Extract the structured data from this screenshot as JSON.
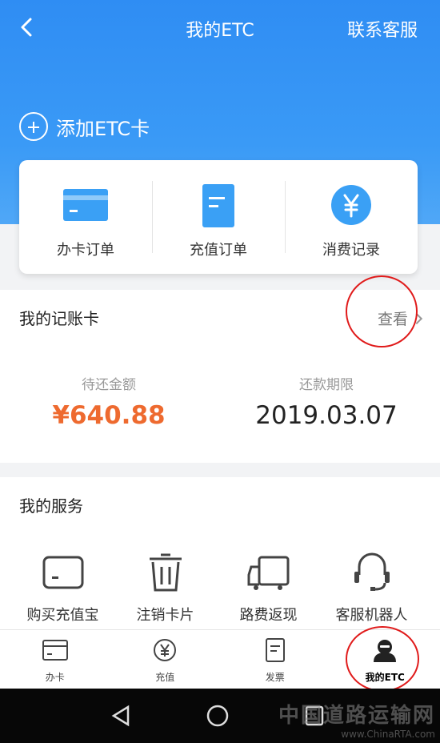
{
  "header": {
    "title": "我的ETC",
    "right_link": "联系客服"
  },
  "add_card": {
    "label": "添加ETC卡"
  },
  "quick": [
    {
      "label": "办卡订单",
      "icon": "card-icon"
    },
    {
      "label": "充值订单",
      "icon": "document-icon"
    },
    {
      "label": "消费记录",
      "icon": "yuan-icon"
    }
  ],
  "account": {
    "title": "我的记账卡",
    "view_label": "查看",
    "due_amount_label": "待还金额",
    "due_amount_value": "¥640.88",
    "due_date_label": "还款期限",
    "due_date_value": "2019.03.07"
  },
  "services": {
    "title": "我的服务",
    "items": [
      {
        "label": "购买充值宝",
        "icon": "device-icon"
      },
      {
        "label": "注销卡片",
        "icon": "trash-icon"
      },
      {
        "label": "路费返现",
        "icon": "truck-icon"
      },
      {
        "label": "客服机器人",
        "icon": "headset-icon"
      }
    ]
  },
  "tabs": [
    {
      "label": "办卡",
      "icon": "card-icon"
    },
    {
      "label": "充值",
      "icon": "yuan-icon"
    },
    {
      "label": "发票",
      "icon": "invoice-icon"
    },
    {
      "label": "我的ETC",
      "icon": "user-icon",
      "active": true
    }
  ],
  "watermark": {
    "line1": "中国道路运输网",
    "line2": "www.ChinaRTA.com"
  },
  "colors": {
    "primary": "#2f8df3",
    "amount": "#ee6a2f",
    "annotation": "#e01b1b"
  }
}
